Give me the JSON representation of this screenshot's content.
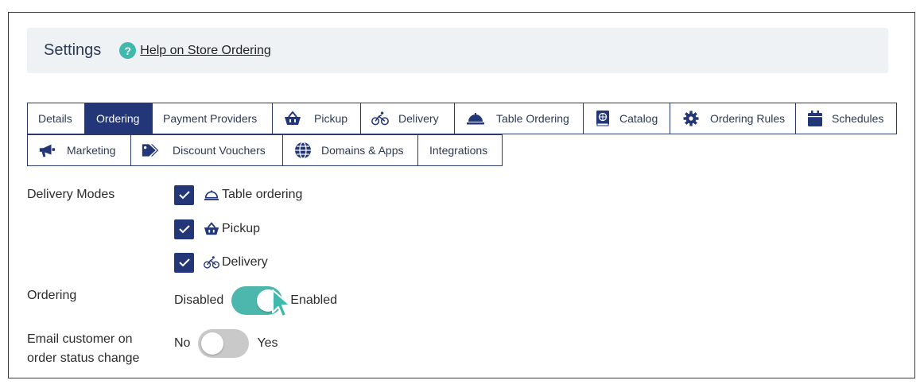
{
  "header": {
    "title": "Settings",
    "help_icon_glyph": "?",
    "help_link": "Help on Store Ordering"
  },
  "tabs_row1": [
    {
      "label": "Details",
      "icon": null,
      "active": false
    },
    {
      "label": "Ordering",
      "icon": null,
      "active": true
    },
    {
      "label": "Payment Providers",
      "icon": null,
      "active": false
    },
    {
      "label": "Pickup",
      "icon": "basket-icon",
      "active": false
    },
    {
      "label": "Delivery",
      "icon": "bicycle-icon",
      "active": false
    },
    {
      "label": "Table Ordering",
      "icon": "cloche-icon",
      "active": false
    },
    {
      "label": "Catalog",
      "icon": "book-icon",
      "active": false
    },
    {
      "label": "Ordering Rules",
      "icon": "gear-icon",
      "active": false
    },
    {
      "label": "Schedules",
      "icon": "calendar-icon",
      "active": false
    }
  ],
  "tabs_row2": [
    {
      "label": "Marketing",
      "icon": "megaphone-icon",
      "active": false
    },
    {
      "label": "Discount Vouchers",
      "icon": "tags-icon",
      "active": false
    },
    {
      "label": "Domains & Apps",
      "icon": "globe-icon",
      "active": false
    },
    {
      "label": "Integrations",
      "icon": null,
      "active": false
    }
  ],
  "delivery_modes": {
    "label": "Delivery Modes",
    "options": [
      {
        "label": "Table ordering",
        "icon": "cloche-outline-icon",
        "checked": true
      },
      {
        "label": "Pickup",
        "icon": "basket-icon",
        "checked": true
      },
      {
        "label": "Delivery",
        "icon": "bicycle-icon",
        "checked": true
      }
    ]
  },
  "ordering": {
    "label": "Ordering",
    "off_label": "Disabled",
    "on_label": "Enabled",
    "enabled": true
  },
  "email_customer": {
    "label_line1": "Email customer on",
    "label_line2": "order status change",
    "off_label": "No",
    "on_label": "Yes",
    "enabled": false
  },
  "colors": {
    "primary": "#233677",
    "accent": "#4cb8ad",
    "header_bg": "#eef2f4"
  }
}
